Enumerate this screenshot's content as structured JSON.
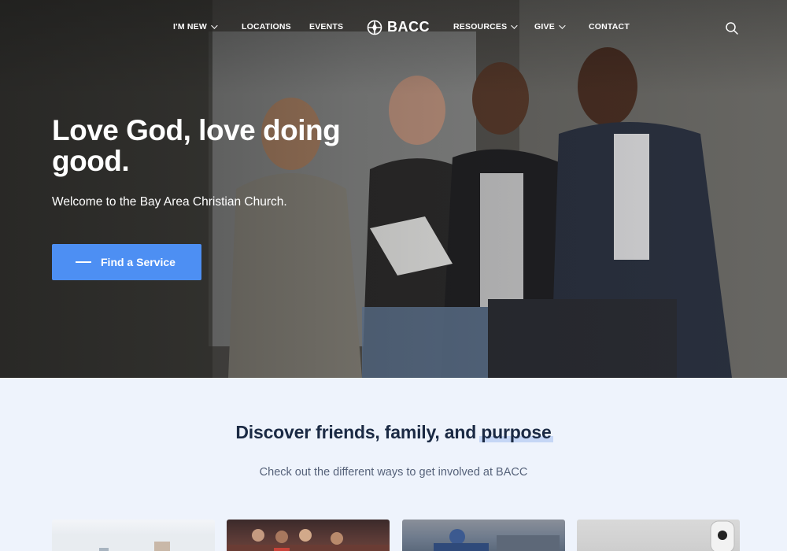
{
  "nav": {
    "items_left": [
      {
        "label": "I'M NEW",
        "dropdown": true
      },
      {
        "label": "LOCATIONS",
        "dropdown": false
      },
      {
        "label": "EVENTS",
        "dropdown": false
      }
    ],
    "logo_text": "BACC",
    "items_right": [
      {
        "label": "RESOURCES",
        "dropdown": true
      },
      {
        "label": "GIVE",
        "dropdown": true
      },
      {
        "label": "CONTACT",
        "dropdown": false
      }
    ],
    "search_icon": "search-icon"
  },
  "hero": {
    "headline_part1": "Love ",
    "headline_highlight": "God",
    "headline_part2": ", love doing good.",
    "subheadline": "Welcome to the Bay Area Christian Church.",
    "cta_label": "Find a Service"
  },
  "section": {
    "title_part1": "Discover friends, family, and ",
    "title_highlight": "purpose",
    "subtitle": "Check out the different ways to get involved at BACC"
  },
  "colors": {
    "accent": "#4d8ff3",
    "heading": "#1b2a44",
    "section_bg": "#eef3fc"
  }
}
